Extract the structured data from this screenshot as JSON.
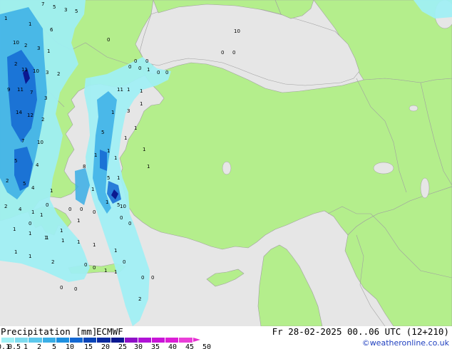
{
  "footer": {
    "title": "Precipitation [mm]",
    "model": "ECMWF",
    "valid": "Fr 28-02-2025 00..06 UTC (12+210)",
    "credit": "©weatheronline.co.uk"
  },
  "legend": {
    "ticks": [
      "0.1",
      "0.5",
      "1",
      "2",
      "5",
      "10",
      "15",
      "20",
      "25",
      "30",
      "35",
      "40",
      "45",
      "50"
    ],
    "colors": [
      "#9ff0f5",
      "#7fdcef",
      "#5cc8ec",
      "#3aaee6",
      "#1e90e0",
      "#1368d3",
      "#0c45b8",
      "#0a2aa0",
      "#0b1890",
      "#8f10c8",
      "#b012d6",
      "#c914d8",
      "#dc1ed6",
      "#ea3fd8"
    ]
  },
  "map": {
    "colors": {
      "sea": "#e6e6e6",
      "land": "#b4ee8c",
      "border": "#a0a0a0"
    },
    "values": [
      "7",
      "5",
      "3",
      "5",
      "1",
      "6",
      "1",
      "10",
      "2",
      "3",
      "1",
      "2",
      "11",
      "10",
      "3",
      "2",
      "9",
      "11",
      "7",
      "3",
      "14",
      "12",
      "2",
      "7",
      "10",
      "5",
      "4",
      "4",
      "5",
      "2",
      "1",
      "4",
      "1",
      "2",
      "1",
      "1",
      "1",
      "1",
      "1",
      "1",
      "1",
      "5",
      "1",
      "1",
      "5",
      "10",
      "8",
      "1",
      "0",
      "0",
      "0",
      "0",
      "0",
      "10",
      "1",
      "1",
      "11",
      "5",
      "1",
      "1",
      "1",
      "3",
      "1",
      "1",
      "1",
      "1",
      "1",
      "1",
      "1",
      "2",
      "1",
      "1",
      "0",
      "0",
      "0",
      "0",
      "0",
      "2",
      "0",
      "0",
      "1",
      "1",
      "0",
      "0",
      "0",
      "0",
      "0",
      "0",
      "0",
      "0",
      "0",
      "0",
      "0",
      "1",
      "1",
      "1",
      "1"
    ]
  }
}
